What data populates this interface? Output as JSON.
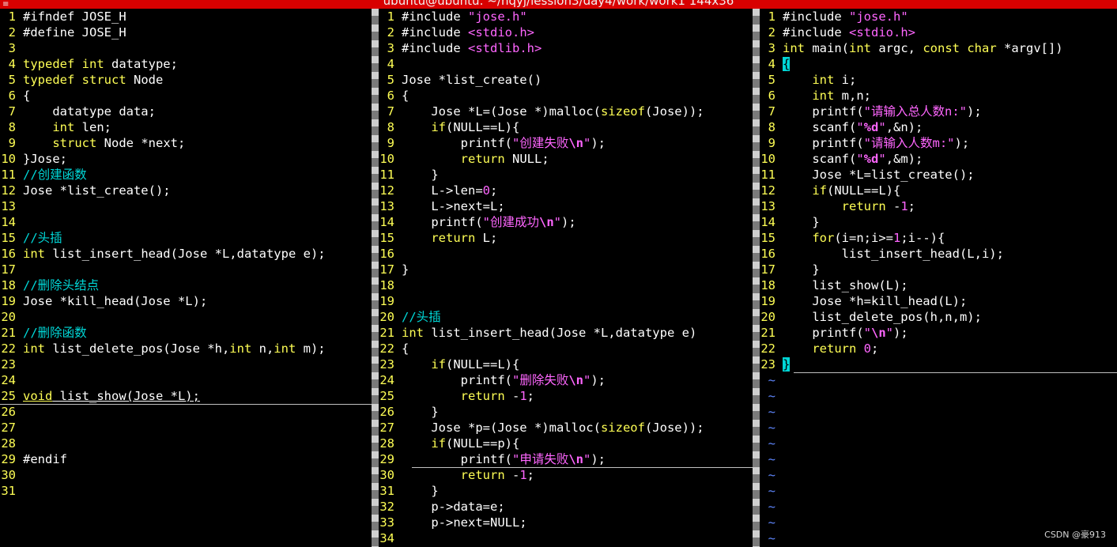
{
  "window": {
    "title": "ubuntu@ubuntu: ~/hqyj/lession3/day4/work/work1 144x36"
  },
  "theme": {
    "title_bar": "#d80000",
    "background": "#000000",
    "line_number": "#ffff55",
    "keyword": "#ffff55",
    "string": "#ff66ff",
    "comment": "#00d7d7",
    "tilde": "#5f87ff",
    "cursor": "#00d7d7"
  },
  "panes": [
    {
      "name": "header-pane",
      "lines": [
        {
          "n": "1",
          "segs": [
            {
              "t": "#ifndef JOSE_H"
            }
          ]
        },
        {
          "n": "2",
          "segs": [
            {
              "t": "#define JOSE_H"
            }
          ]
        },
        {
          "n": "3",
          "segs": []
        },
        {
          "n": "4",
          "segs": [
            {
              "t": "typedef int",
              "c": "kw"
            },
            {
              "t": " datatype;"
            }
          ]
        },
        {
          "n": "5",
          "segs": [
            {
              "t": "typedef struct",
              "c": "kw"
            },
            {
              "t": " Node"
            }
          ]
        },
        {
          "n": "6",
          "segs": [
            {
              "t": "{"
            }
          ]
        },
        {
          "n": "7",
          "segs": [
            {
              "t": "    datatype data;"
            }
          ]
        },
        {
          "n": "8",
          "segs": [
            {
              "t": "    "
            },
            {
              "t": "int",
              "c": "kw"
            },
            {
              "t": " len;"
            }
          ]
        },
        {
          "n": "9",
          "segs": [
            {
              "t": "    "
            },
            {
              "t": "struct",
              "c": "kw"
            },
            {
              "t": " Node "
            },
            {
              "t": "*next;"
            }
          ]
        },
        {
          "n": "10",
          "segs": [
            {
              "t": "}Jose;"
            }
          ]
        },
        {
          "n": "11",
          "segs": [
            {
              "t": "//创建函数",
              "c": "cm"
            }
          ]
        },
        {
          "n": "12",
          "segs": [
            {
              "t": "Jose *list_create();"
            }
          ]
        },
        {
          "n": "13",
          "segs": []
        },
        {
          "n": "14",
          "segs": []
        },
        {
          "n": "15",
          "segs": [
            {
              "t": "//头插",
              "c": "cm"
            }
          ]
        },
        {
          "n": "16",
          "segs": [
            {
              "t": "int",
              "c": "kw"
            },
            {
              "t": " list_insert_head(Jose *L,datatype e);"
            }
          ]
        },
        {
          "n": "17",
          "segs": []
        },
        {
          "n": "18",
          "segs": [
            {
              "t": "//删除头结点",
              "c": "cm"
            }
          ]
        },
        {
          "n": "19",
          "segs": [
            {
              "t": "Jose *kill_head(Jose *L);"
            }
          ]
        },
        {
          "n": "20",
          "segs": []
        },
        {
          "n": "21",
          "segs": [
            {
              "t": "//删除函数",
              "c": "cm"
            }
          ]
        },
        {
          "n": "22",
          "segs": [
            {
              "t": "int",
              "c": "kw"
            },
            {
              "t": " list_delete_pos(Jose *h,"
            },
            {
              "t": "int",
              "c": "kw"
            },
            {
              "t": " n,"
            },
            {
              "t": "int",
              "c": "kw"
            },
            {
              "t": " m);"
            }
          ]
        },
        {
          "n": "23",
          "segs": []
        },
        {
          "n": "24",
          "segs": []
        },
        {
          "n": "25",
          "segs": [
            {
              "t": "void",
              "c": "kw ul"
            },
            {
              "t": " list_show(Jose *L);",
              "c": "ul"
            }
          ]
        },
        {
          "n": "26",
          "segs": []
        },
        {
          "n": "27",
          "segs": []
        },
        {
          "n": "28",
          "segs": []
        },
        {
          "n": "29",
          "segs": [
            {
              "t": "#endif"
            }
          ]
        },
        {
          "n": "30",
          "segs": []
        },
        {
          "n": "31",
          "segs": []
        }
      ]
    },
    {
      "name": "source-pane",
      "lines": [
        {
          "n": "1",
          "segs": [
            {
              "t": "#include "
            },
            {
              "t": "\"jose.h\"",
              "c": "str"
            }
          ]
        },
        {
          "n": "2",
          "segs": [
            {
              "t": "#include "
            },
            {
              "t": "<stdio.h>",
              "c": "str"
            }
          ]
        },
        {
          "n": "3",
          "segs": [
            {
              "t": "#include "
            },
            {
              "t": "<stdlib.h>",
              "c": "str"
            }
          ]
        },
        {
          "n": "4",
          "segs": []
        },
        {
          "n": "5",
          "segs": [
            {
              "t": "Jose *list_create()"
            }
          ]
        },
        {
          "n": "6",
          "segs": [
            {
              "t": "{"
            }
          ]
        },
        {
          "n": "7",
          "segs": [
            {
              "t": "    Jose *L=(Jose *)malloc("
            },
            {
              "t": "sizeof",
              "c": "kw"
            },
            {
              "t": "(Jose));"
            }
          ]
        },
        {
          "n": "8",
          "segs": [
            {
              "t": "    "
            },
            {
              "t": "if",
              "c": "kw"
            },
            {
              "t": "(NULL==L){"
            }
          ]
        },
        {
          "n": "9",
          "segs": [
            {
              "t": "        printf("
            },
            {
              "t": "\"创建失败",
              "c": "str"
            },
            {
              "t": "\\n",
              "c": "esc"
            },
            {
              "t": "\"",
              "c": "str"
            },
            {
              "t": ");"
            }
          ]
        },
        {
          "n": "10",
          "segs": [
            {
              "t": "        "
            },
            {
              "t": "return",
              "c": "kw"
            },
            {
              "t": " NULL;"
            }
          ]
        },
        {
          "n": "11",
          "segs": [
            {
              "t": "    }"
            }
          ]
        },
        {
          "n": "12",
          "segs": [
            {
              "t": "    L->len="
            },
            {
              "t": "0",
              "c": "str"
            },
            {
              "t": ";"
            }
          ]
        },
        {
          "n": "13",
          "segs": [
            {
              "t": "    L->next=L;"
            }
          ]
        },
        {
          "n": "14",
          "segs": [
            {
              "t": "    printf("
            },
            {
              "t": "\"创建成功",
              "c": "str"
            },
            {
              "t": "\\n",
              "c": "esc"
            },
            {
              "t": "\"",
              "c": "str"
            },
            {
              "t": ");"
            }
          ]
        },
        {
          "n": "15",
          "segs": [
            {
              "t": "    "
            },
            {
              "t": "return",
              "c": "kw"
            },
            {
              "t": " L;"
            }
          ]
        },
        {
          "n": "16",
          "segs": []
        },
        {
          "n": "17",
          "segs": [
            {
              "t": "}"
            }
          ]
        },
        {
          "n": "18",
          "segs": []
        },
        {
          "n": "19",
          "segs": []
        },
        {
          "n": "20",
          "segs": [
            {
              "t": "//头插",
              "c": "cm"
            }
          ]
        },
        {
          "n": "21",
          "segs": [
            {
              "t": "int",
              "c": "kw"
            },
            {
              "t": " list_insert_head(Jose *L,datatype e)"
            }
          ]
        },
        {
          "n": "22",
          "segs": [
            {
              "t": "{"
            }
          ]
        },
        {
          "n": "23",
          "segs": [
            {
              "t": "    "
            },
            {
              "t": "if",
              "c": "kw"
            },
            {
              "t": "(NULL==L){"
            }
          ]
        },
        {
          "n": "24",
          "segs": [
            {
              "t": "        printf("
            },
            {
              "t": "\"删除失败",
              "c": "str"
            },
            {
              "t": "\\n",
              "c": "esc"
            },
            {
              "t": "\"",
              "c": "str"
            },
            {
              "t": ");"
            }
          ]
        },
        {
          "n": "25",
          "segs": [
            {
              "t": "        "
            },
            {
              "t": "return",
              "c": "kw"
            },
            {
              "t": " -"
            },
            {
              "t": "1",
              "c": "str"
            },
            {
              "t": ";"
            }
          ]
        },
        {
          "n": "26",
          "segs": [
            {
              "t": "    }"
            }
          ]
        },
        {
          "n": "27",
          "segs": [
            {
              "t": "    Jose *p=(Jose *)malloc("
            },
            {
              "t": "sizeof",
              "c": "kw"
            },
            {
              "t": "(Jose));"
            }
          ]
        },
        {
          "n": "28",
          "segs": [
            {
              "t": "    "
            },
            {
              "t": "if",
              "c": "kw"
            },
            {
              "t": "(NULL==p){"
            }
          ]
        },
        {
          "n": "29",
          "segs": [
            {
              "t": "        printf("
            },
            {
              "t": "\"申请失败",
              "c": "str"
            },
            {
              "t": "\\n",
              "c": "esc"
            },
            {
              "t": "\"",
              "c": "str"
            },
            {
              "t": ");"
            }
          ]
        },
        {
          "n": "30",
          "segs": [
            {
              "t": "        "
            },
            {
              "t": "return",
              "c": "kw"
            },
            {
              "t": " -"
            },
            {
              "t": "1",
              "c": "str"
            },
            {
              "t": ";"
            }
          ]
        },
        {
          "n": "31",
          "segs": [
            {
              "t": "    }"
            }
          ]
        },
        {
          "n": "32",
          "segs": [
            {
              "t": "    p->data=e;"
            }
          ]
        },
        {
          "n": "33",
          "segs": [
            {
              "t": "    p->next=NULL;"
            }
          ]
        },
        {
          "n": "34",
          "segs": []
        }
      ]
    },
    {
      "name": "main-pane",
      "lines": [
        {
          "n": "1",
          "segs": [
            {
              "t": "#include "
            },
            {
              "t": "\"jose.h\"",
              "c": "str"
            }
          ]
        },
        {
          "n": "2",
          "segs": [
            {
              "t": "#include "
            },
            {
              "t": "<stdio.h>",
              "c": "str"
            }
          ]
        },
        {
          "n": "3",
          "segs": [
            {
              "t": "int",
              "c": "kw"
            },
            {
              "t": " main("
            },
            {
              "t": "int",
              "c": "kw"
            },
            {
              "t": " argc, "
            },
            {
              "t": "const char",
              "c": "kw"
            },
            {
              "t": " *argv[])"
            }
          ]
        },
        {
          "n": "4",
          "segs": [
            {
              "t": "{",
              "c": "cur"
            }
          ]
        },
        {
          "n": "5",
          "segs": [
            {
              "t": "    "
            },
            {
              "t": "int",
              "c": "kw"
            },
            {
              "t": " i;"
            }
          ]
        },
        {
          "n": "6",
          "segs": [
            {
              "t": "    "
            },
            {
              "t": "int",
              "c": "kw"
            },
            {
              "t": " m,n;"
            }
          ]
        },
        {
          "n": "7",
          "segs": [
            {
              "t": "    printf("
            },
            {
              "t": "\"请输入总人数n:\"",
              "c": "str"
            },
            {
              "t": ");"
            }
          ]
        },
        {
          "n": "8",
          "segs": [
            {
              "t": "    scanf("
            },
            {
              "t": "\"",
              "c": "str"
            },
            {
              "t": "%d",
              "c": "esc"
            },
            {
              "t": "\"",
              "c": "str"
            },
            {
              "t": ",&n);"
            }
          ]
        },
        {
          "n": "9",
          "segs": [
            {
              "t": "    printf("
            },
            {
              "t": "\"请输入人数m:\"",
              "c": "str"
            },
            {
              "t": ");"
            }
          ]
        },
        {
          "n": "10",
          "segs": [
            {
              "t": "    scanf("
            },
            {
              "t": "\"",
              "c": "str"
            },
            {
              "t": "%d",
              "c": "esc"
            },
            {
              "t": "\"",
              "c": "str"
            },
            {
              "t": ",&m);"
            }
          ]
        },
        {
          "n": "11",
          "segs": [
            {
              "t": "    Jose *L=list_create();"
            }
          ]
        },
        {
          "n": "12",
          "segs": [
            {
              "t": "    "
            },
            {
              "t": "if",
              "c": "kw"
            },
            {
              "t": "(NULL==L){"
            }
          ]
        },
        {
          "n": "13",
          "segs": [
            {
              "t": "        "
            },
            {
              "t": "return",
              "c": "kw"
            },
            {
              "t": " -"
            },
            {
              "t": "1",
              "c": "str"
            },
            {
              "t": ";"
            }
          ]
        },
        {
          "n": "14",
          "segs": [
            {
              "t": "    }"
            }
          ]
        },
        {
          "n": "15",
          "segs": [
            {
              "t": "    "
            },
            {
              "t": "for",
              "c": "kw"
            },
            {
              "t": "(i=n;i>="
            },
            {
              "t": "1",
              "c": "str"
            },
            {
              "t": ";i--){"
            }
          ]
        },
        {
          "n": "16",
          "segs": [
            {
              "t": "        list_insert_head(L,i);"
            }
          ]
        },
        {
          "n": "17",
          "segs": [
            {
              "t": "    }"
            }
          ]
        },
        {
          "n": "18",
          "segs": [
            {
              "t": "    list_show(L);"
            }
          ]
        },
        {
          "n": "19",
          "segs": [
            {
              "t": "    Jose *h=kill_head(L);"
            }
          ]
        },
        {
          "n": "20",
          "segs": [
            {
              "t": "    list_delete_pos(h,n,m);"
            }
          ]
        },
        {
          "n": "21",
          "segs": [
            {
              "t": "    printf("
            },
            {
              "t": "\"",
              "c": "str"
            },
            {
              "t": "\\n",
              "c": "esc"
            },
            {
              "t": "\"",
              "c": "str"
            },
            {
              "t": ");"
            }
          ]
        },
        {
          "n": "22",
          "segs": [
            {
              "t": "    "
            },
            {
              "t": "return",
              "c": "kw"
            },
            {
              "t": " "
            },
            {
              "t": "0",
              "c": "str"
            },
            {
              "t": ";"
            }
          ]
        },
        {
          "n": "23",
          "segs": [
            {
              "t": "}",
              "c": "cur"
            }
          ]
        },
        {
          "n": "~",
          "segs": []
        },
        {
          "n": "~",
          "segs": []
        },
        {
          "n": "~",
          "segs": []
        },
        {
          "n": "~",
          "segs": []
        },
        {
          "n": "~",
          "segs": []
        },
        {
          "n": "~",
          "segs": []
        },
        {
          "n": "~",
          "segs": []
        },
        {
          "n": "~",
          "segs": []
        },
        {
          "n": "~",
          "segs": []
        },
        {
          "n": "~",
          "segs": []
        },
        {
          "n": "~",
          "segs": []
        },
        {
          "n": "~",
          "segs": []
        }
      ]
    }
  ],
  "watermark": "CSDN @豪913"
}
